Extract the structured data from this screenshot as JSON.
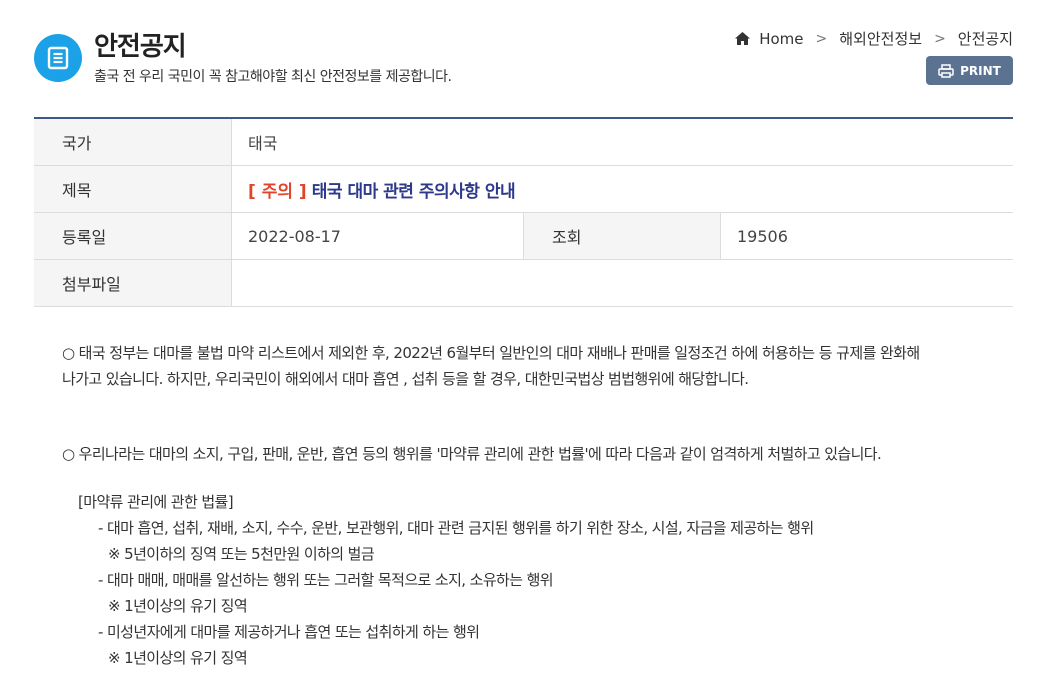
{
  "header": {
    "title": "안전공지",
    "subtitle": "출국 전 우리 국민이 꼭 참고해야할 최신 안전정보를 제공합니다.",
    "icon": "document-list-icon"
  },
  "breadcrumb": {
    "home": "Home",
    "level1": "해외안전정보",
    "level2": "안전공지"
  },
  "print_label": "PRINT",
  "info": {
    "country_label": "국가",
    "country_value": "태국",
    "subject_label": "제목",
    "subject_tag": "[ 주의 ]",
    "subject_title": "태국 대마 관련 주의사항 안내",
    "date_label": "등록일",
    "date_value": "2022-08-17",
    "views_label": "조회",
    "views_value": "19506",
    "attachment_label": "첨부파일",
    "attachment_value": ""
  },
  "content": {
    "para1_line1": "○ 태국 정부는 대마를 불법 마약 리스트에서 제외한 후, 2022년 6월부터 일반인의 대마 재배나 판매를 일정조건 하에 허용하는 등 규제를 완화해",
    "para1_line2": "나가고 있습니다. 하지만, 우리국민이 해외에서 대마 흡연 , 섭취 등을 할 경우, 대한민국법상 범법행위에 해당합니다.",
    "para2": "○ 우리나라는 대마의 소지, 구입, 판매, 운반, 흡연 등의 행위를 '마약류 관리에 관한 법률'에 따라 다음과 같이 엄격하게 처벌하고 있습니다.",
    "law_title": "[마약류 관리에 관한 법률]",
    "item1": "- 대마 흡연, 섭취, 재배, 소지, 수수, 운반, 보관행위, 대마 관련 금지된 행위를 하기 위한 장소, 시설, 자금을 제공하는 행위",
    "item1_penalty": "※ 5년이하의 징역 또는 5천만원 이하의 벌금",
    "item2": "- 대마 매매, 매매를 알선하는 행위 또는 그러할 목적으로 소지, 소유하는 행위",
    "item2_penalty": "※ 1년이상의 유기 징역",
    "item3": "- 미성년자에게 대마를 제공하거나 흡연 또는 섭취하게 하는 행위",
    "item3_penalty": "※ 1년이상의 유기 징역"
  },
  "colors": {
    "accent_blue": "#1aa1e8",
    "print_button": "#5b7291",
    "table_top_border": "#3b5a8a",
    "caution_red": "#e0452b",
    "title_navy": "#2d3a8c"
  }
}
